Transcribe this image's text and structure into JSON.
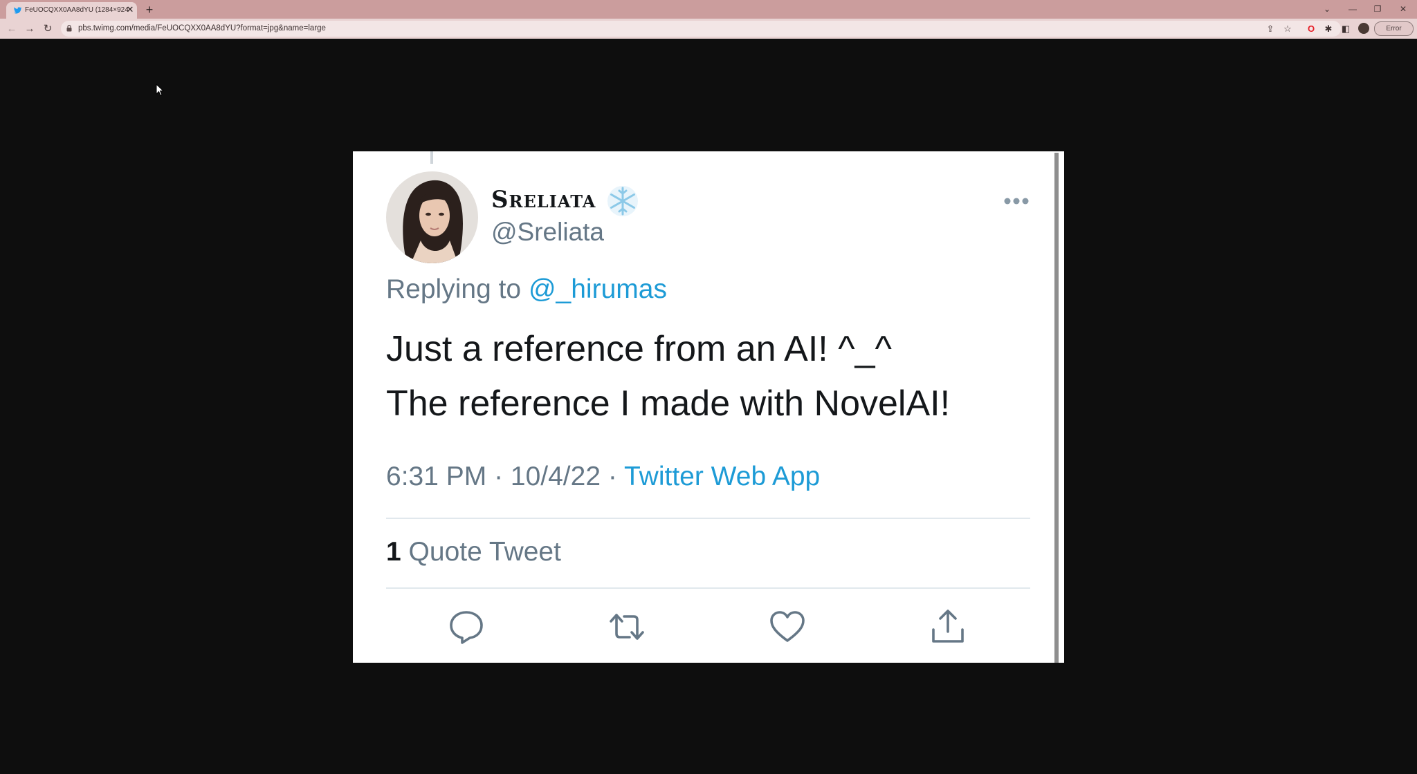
{
  "browser": {
    "tab_title": "FeUOCQXX0AA8dYU (1284×924)",
    "tab_close": "✕",
    "new_tab": "+",
    "url": "pbs.twimg.com/media/FeUOCQXX0AA8dYU?format=jpg&name=large",
    "profile_status": "Error",
    "controls": {
      "dropdown": "⌄",
      "minimize": "—",
      "restore": "❐",
      "close": "✕"
    },
    "nav": {
      "back": "←",
      "forward": "→",
      "reload": "↻"
    }
  },
  "tweet": {
    "display_name": "Sreliata",
    "handle": "@Sreliata",
    "replying_prefix": "Replying to ",
    "replying_to": "@_hirumas",
    "text_line1": "Just a reference from an AI! ^_^",
    "text_line2": "The reference I made with NovelAI!",
    "time": "6:31 PM · 10/4/22 · ",
    "source": "Twitter Web App",
    "quote_count": "1",
    "quote_label": " Quote Tweet"
  },
  "colors": {
    "tab_strip": "#cb9d9d",
    "toolbar": "#e9d3d3",
    "page_background": "#0e0e0e",
    "tweet_link": "#1d9bd6",
    "tweet_secondary": "#657786"
  },
  "icons": {
    "tab_favicon": "twitter-bird-icon",
    "badge": "snowflake-icon",
    "more": "more-dots-icon",
    "actions": [
      "reply-icon",
      "retweet-icon",
      "like-icon",
      "share-icon"
    ]
  }
}
